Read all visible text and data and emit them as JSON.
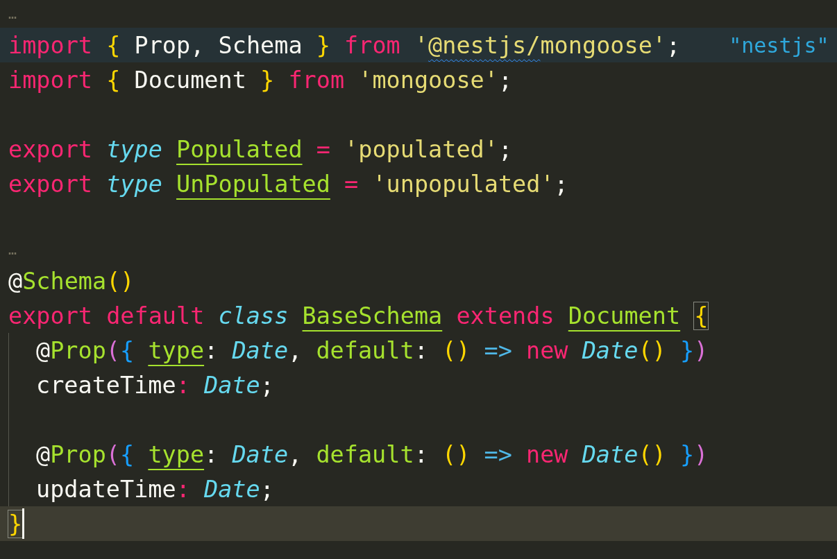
{
  "lines": [
    {
      "kind": "fold",
      "text": "…"
    },
    {
      "kind": "selected",
      "tokens": [
        {
          "kind": "kw",
          "text": "import "
        },
        {
          "kind": "gold",
          "text": "{"
        },
        {
          "kind": "plain",
          "text": " Prop, Schema "
        },
        {
          "kind": "gold",
          "text": "} "
        },
        {
          "kind": "kw",
          "text": "from "
        },
        {
          "kind": "str",
          "text": "'"
        },
        {
          "kind": "str-warn",
          "text": "@nestjs/"
        },
        {
          "kind": "str",
          "text": "mongoose'"
        },
        {
          "kind": "plain",
          "text": ";"
        },
        {
          "kind": "inlay",
          "text": "\"nestjs\""
        }
      ]
    },
    {
      "kind": "code",
      "tokens": [
        {
          "kind": "kw",
          "text": "import "
        },
        {
          "kind": "gold",
          "text": "{"
        },
        {
          "kind": "plain",
          "text": " Document "
        },
        {
          "kind": "gold",
          "text": "} "
        },
        {
          "kind": "kw",
          "text": "from "
        },
        {
          "kind": "str",
          "text": "'mongoose'"
        },
        {
          "kind": "plain",
          "text": ";"
        }
      ]
    },
    {
      "kind": "blank"
    },
    {
      "kind": "code",
      "tokens": [
        {
          "kind": "kw",
          "text": "export "
        },
        {
          "kind": "storage",
          "text": "type "
        },
        {
          "kind": "typedef",
          "text": "Populated"
        },
        {
          "kind": "kw",
          "text": " = "
        },
        {
          "kind": "str",
          "text": "'populated'"
        },
        {
          "kind": "plain",
          "text": ";"
        }
      ]
    },
    {
      "kind": "code",
      "tokens": [
        {
          "kind": "kw",
          "text": "export "
        },
        {
          "kind": "storage",
          "text": "type "
        },
        {
          "kind": "typedef",
          "text": "UnPopulated"
        },
        {
          "kind": "kw",
          "text": " = "
        },
        {
          "kind": "str",
          "text": "'unpopulated'"
        },
        {
          "kind": "plain",
          "text": ";"
        }
      ]
    },
    {
      "kind": "blank"
    },
    {
      "kind": "fold",
      "text": "…"
    },
    {
      "kind": "code",
      "tokens": [
        {
          "kind": "plain",
          "text": "@"
        },
        {
          "kind": "fn",
          "text": "Schema"
        },
        {
          "kind": "gold",
          "text": "()"
        }
      ]
    },
    {
      "kind": "code",
      "tokens": [
        {
          "kind": "kw",
          "text": "export default "
        },
        {
          "kind": "storage",
          "text": "class "
        },
        {
          "kind": "typedef",
          "text": "BaseSchema"
        },
        {
          "kind": "kw",
          "text": " extends "
        },
        {
          "kind": "typedef",
          "text": "Document"
        },
        {
          "kind": "gold-match-gap",
          "text": "{"
        }
      ],
      "children": [
        {
          "kind": "code",
          "tokens": [
            {
              "kind": "plain",
              "text": "@"
            },
            {
              "kind": "fn",
              "text": "Prop"
            },
            {
              "kind": "orchid",
              "text": "("
            },
            {
              "kind": "blue",
              "text": "{ "
            },
            {
              "kind": "propref",
              "text": "type"
            },
            {
              "kind": "plain",
              "text": ": "
            },
            {
              "kind": "typeref",
              "text": "Date"
            },
            {
              "kind": "plain",
              "text": ", "
            },
            {
              "kind": "fn",
              "text": "default"
            },
            {
              "kind": "plain",
              "text": ": "
            },
            {
              "kind": "gold",
              "text": "() "
            },
            {
              "kind": "arrow",
              "text": "=> "
            },
            {
              "kind": "kw",
              "text": "new "
            },
            {
              "kind": "typeref",
              "text": "Date"
            },
            {
              "kind": "gold",
              "text": "() "
            },
            {
              "kind": "blue",
              "text": "}"
            },
            {
              "kind": "orchid",
              "text": ")"
            }
          ]
        },
        {
          "kind": "code",
          "tokens": [
            {
              "kind": "plain",
              "text": "createTime"
            },
            {
              "kind": "kw",
              "text": ": "
            },
            {
              "kind": "typeref",
              "text": "Date"
            },
            {
              "kind": "plain",
              "text": ";"
            }
          ]
        },
        {
          "kind": "blank"
        },
        {
          "kind": "code",
          "tokens": [
            {
              "kind": "plain",
              "text": "@"
            },
            {
              "kind": "fn",
              "text": "Prop"
            },
            {
              "kind": "orchid",
              "text": "("
            },
            {
              "kind": "blue",
              "text": "{ "
            },
            {
              "kind": "propref",
              "text": "type"
            },
            {
              "kind": "plain",
              "text": ": "
            },
            {
              "kind": "typeref",
              "text": "Date"
            },
            {
              "kind": "plain",
              "text": ", "
            },
            {
              "kind": "fn",
              "text": "default"
            },
            {
              "kind": "plain",
              "text": ": "
            },
            {
              "kind": "gold",
              "text": "() "
            },
            {
              "kind": "arrow",
              "text": "=> "
            },
            {
              "kind": "kw",
              "text": "new "
            },
            {
              "kind": "typeref",
              "text": "Date"
            },
            {
              "kind": "gold",
              "text": "() "
            },
            {
              "kind": "blue",
              "text": "}"
            },
            {
              "kind": "orchid",
              "text": ")"
            }
          ]
        },
        {
          "kind": "code",
          "tokens": [
            {
              "kind": "plain",
              "text": "updateTime"
            },
            {
              "kind": "kw",
              "text": ": "
            },
            {
              "kind": "typeref",
              "text": "Date"
            },
            {
              "kind": "plain",
              "text": ";"
            }
          ]
        }
      ]
    },
    {
      "kind": "current",
      "tokens": [
        {
          "kind": "gold-match",
          "text": "}"
        }
      ]
    }
  ]
}
